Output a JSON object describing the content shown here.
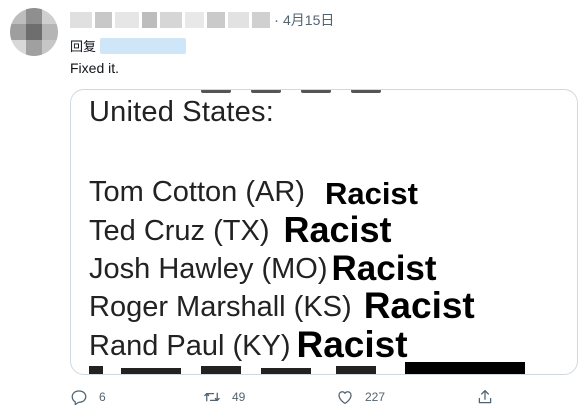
{
  "tweet": {
    "date": "4月15日",
    "reply_prefix": "回复",
    "text": "Fixed it."
  },
  "image": {
    "heading": "United States:",
    "rows": [
      {
        "name": "Tom Cotton (AR)",
        "label": "Racist"
      },
      {
        "name": "Ted Cruz (TX)",
        "label": "Racist"
      },
      {
        "name": "Josh Hawley (MO)",
        "label": "Racist"
      },
      {
        "name": "Roger Marshall (KS)",
        "label": "Racist"
      },
      {
        "name": "Rand Paul (KY)",
        "label": "Racist"
      }
    ]
  },
  "actions": {
    "reply_count": "6",
    "retweet_count": "49",
    "like_count": "227"
  },
  "icons": [
    "reply-icon",
    "retweet-icon",
    "like-icon",
    "share-icon"
  ],
  "colors": {
    "muted": "#536471",
    "border": "#cfd9de"
  }
}
